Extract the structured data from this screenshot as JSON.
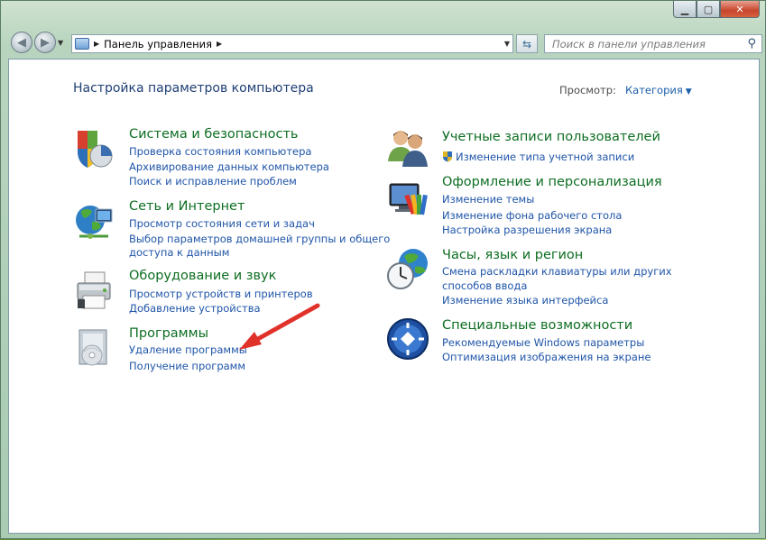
{
  "window": {
    "caption": {
      "minimize": "▁",
      "maximize": "▢",
      "close": "✕"
    }
  },
  "nav": {
    "back_icon": "back-arrow-icon",
    "forward_icon": "forward-arrow-icon",
    "breadcrumb": [
      "Панель управления"
    ],
    "search_placeholder": "Поиск в панели управления"
  },
  "page": {
    "title": "Настройка параметров компьютера",
    "view_by_label": "Просмотр:",
    "view_by_value": "Категория"
  },
  "categories_left": [
    {
      "title": "Система и безопасность",
      "icon": "shield-pie-icon",
      "links": [
        "Проверка состояния компьютера",
        "Архивирование данных компьютера",
        "Поиск и исправление проблем"
      ]
    },
    {
      "title": "Сеть и Интернет",
      "icon": "globe-network-icon",
      "links": [
        "Просмотр состояния сети и задач",
        "Выбор параметров домашней группы и общего",
        "доступа к данным"
      ]
    },
    {
      "title": "Оборудование и звук",
      "icon": "printer-icon",
      "links": [
        "Просмотр устройств и принтеров",
        "Добавление устройства"
      ]
    },
    {
      "title": "Программы",
      "icon": "programs-disc-icon",
      "links": [
        "Удаление программы",
        "Получение программ"
      ]
    }
  ],
  "categories_right": [
    {
      "title": "Учетные записи пользователей",
      "icon": "users-icon",
      "links": [
        "Изменение типа учетной записи"
      ]
    },
    {
      "title": "Оформление и персонализация",
      "icon": "monitor-palette-icon",
      "links": [
        "Изменение темы",
        "Изменение фона рабочего стола",
        "Настройка разрешения экрана"
      ]
    },
    {
      "title": "Часы, язык и регион",
      "icon": "clock-globe-icon",
      "links": [
        "Смена раскладки клавиатуры или других",
        "способов ввода",
        "Изменение языка интерфейса"
      ]
    },
    {
      "title": "Специальные возможности",
      "icon": "accessibility-icon",
      "links": [
        "Рекомендуемые Windows параметры",
        "Оптимизация изображения на экране"
      ]
    }
  ],
  "colors": {
    "category_title": "#0e6e22",
    "link": "#1f55a8",
    "page_title": "#1f3f75",
    "annotation_arrow": "#e0322b"
  }
}
